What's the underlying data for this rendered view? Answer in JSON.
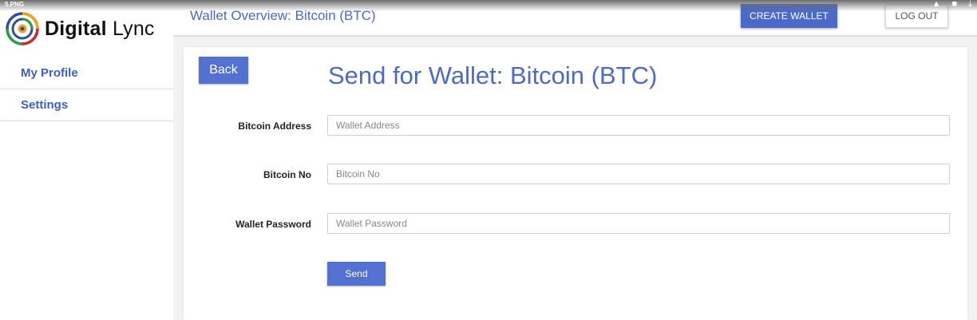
{
  "viewer": {
    "file_name": "5.PNG",
    "icons": [
      "drive-icon",
      "print-icon",
      "download-icon"
    ]
  },
  "brand": {
    "name_bold": "Digital",
    "name_light": "Lync"
  },
  "sidebar": {
    "items": [
      {
        "label": "My Profile"
      },
      {
        "label": "Settings"
      }
    ]
  },
  "header": {
    "title": "Wallet Overview: Bitcoin (BTC)",
    "create_wallet_label": "CREATE WALLET",
    "logout_label": "LOG OUT"
  },
  "form": {
    "back_label": "Back",
    "title": "Send for Wallet: Bitcoin (BTC)",
    "fields": [
      {
        "label": "Bitcoin Address",
        "placeholder": "Wallet Address",
        "value": ""
      },
      {
        "label": "Bitcoin No",
        "placeholder": "Bitcoin No",
        "value": ""
      },
      {
        "label": "Wallet Password",
        "placeholder": "Wallet Password",
        "value": ""
      }
    ],
    "send_label": "Send"
  },
  "colors": {
    "accent": "#4c6ac8",
    "link": "#3f5fbf",
    "title": "#4d6ac5"
  }
}
